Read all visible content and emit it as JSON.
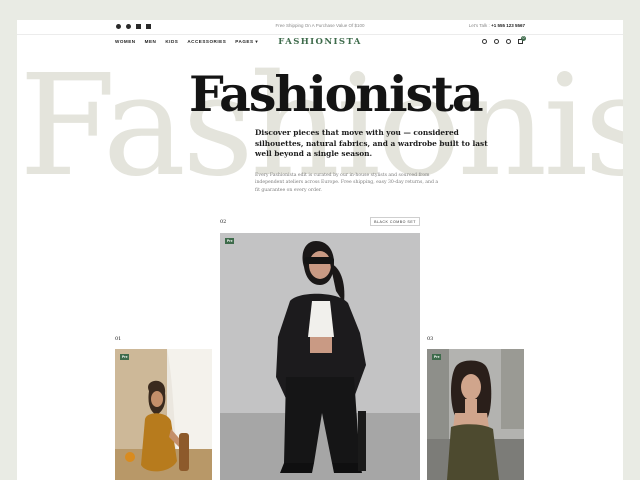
{
  "topbar": {
    "shipping": "Free Shipping On A Purchase Value Of $100",
    "talk_label": "Let's Talk :",
    "talk_phone": "+1 555 123 5567"
  },
  "nav": {
    "items": [
      "WOMEN",
      "MEN",
      "KIDS",
      "ACCESSORIES",
      "PAGES"
    ],
    "logo": "FASHIONISTA",
    "cart_count": "0"
  },
  "hero": {
    "bg_word": "Fashionista",
    "title": "Fashionista",
    "tagline": "Discover pieces that move with you — considered silhouettes, natural fabrics, and a wardrobe built to last well beyond a single season.",
    "description": "Every Fashionista edit is curated by our in-house stylists and sourced from independent ateliers across Europe. Free shipping, easy 30-day returns, and a fit guarantee on every order."
  },
  "products": [
    {
      "number": "01",
      "badge": "Pre"
    },
    {
      "number": "02",
      "badge": "Pre",
      "tag": "BLACK COMBO SET"
    },
    {
      "number": "03",
      "badge": "Pre"
    }
  ],
  "colors": {
    "accent": "#3e6b4b",
    "frame": "#e9ebe4"
  }
}
